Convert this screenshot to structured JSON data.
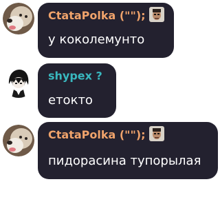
{
  "messages": [
    {
      "author": "CtataPolka (\"\");",
      "author_color": "#f0a36b",
      "has_badge": true,
      "avatar": "dog-avatar",
      "text": "у коколемунто"
    },
    {
      "author": "shypex ?",
      "author_color": "#39b8bf",
      "has_badge": false,
      "avatar": "anime-character-avatar",
      "text": "етокто"
    },
    {
      "author": "CtataPolka (\"\");",
      "author_color": "#f0a36b",
      "has_badge": true,
      "avatar": "dog-avatar",
      "text": "пидорасина тупорылая"
    }
  ],
  "colors": {
    "bubble_background": "#23212f",
    "message_text": "#ffffff"
  }
}
